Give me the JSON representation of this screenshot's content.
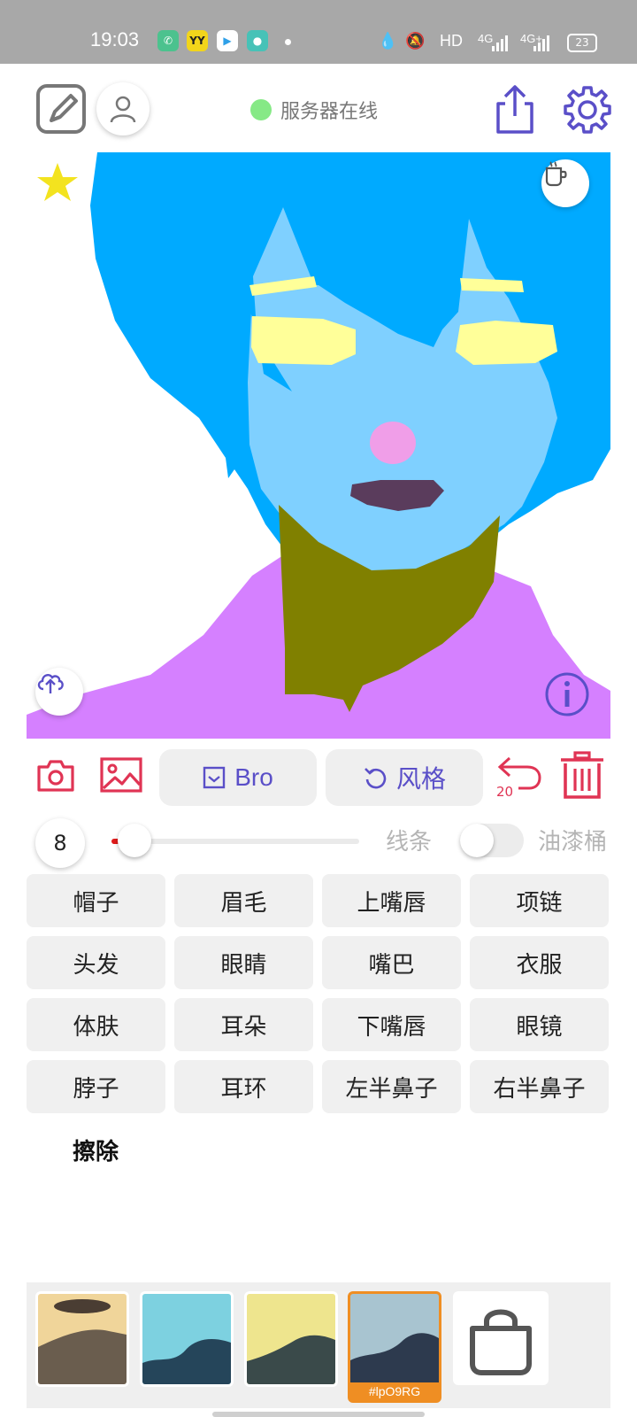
{
  "status_bar": {
    "time": "19:03",
    "network_label": "HD",
    "signal_label_1": "4G",
    "signal_label_2": "4G+",
    "battery": "23",
    "icons": [
      "phone-app-icon",
      "yy-app-icon",
      "video-app-icon",
      "chat-app-icon",
      "water-drop-icon",
      "mute-icon"
    ]
  },
  "toolbar": {
    "server_status": "服务器在线",
    "server_status_color": "#86e986",
    "icons": [
      "edit-icon",
      "user-icon",
      "share-icon",
      "settings-icon"
    ]
  },
  "canvas": {
    "icons": [
      "star-icon",
      "coffee-icon",
      "upload-cloud-icon",
      "info-icon"
    ]
  },
  "actions": {
    "model_label": "Bro",
    "style_label": "风格",
    "undo_count": "20",
    "icons": [
      "camera-icon",
      "image-icon",
      "checkbox-icon",
      "refresh-icon",
      "undo-icon",
      "trash-icon"
    ]
  },
  "brush": {
    "size": "8",
    "line_label": "线条",
    "bucket_label": "油漆桶",
    "slider_fraction": 0.04,
    "bucket_enabled": false
  },
  "parts": [
    "帽子",
    "眉毛",
    "上嘴唇",
    "项链",
    "头发",
    "眼睛",
    "嘴巴",
    "衣服",
    "体肤",
    "耳朵",
    "下嘴唇",
    "眼镜",
    "脖子",
    "耳环",
    "左半鼻子",
    "右半鼻子"
  ],
  "erase_label": "擦除",
  "thumbnails": {
    "selected_label": "#lpO9RG"
  },
  "colors": {
    "accent_purple": "#5a4fc8",
    "accent_red": "#e03454",
    "hair": "#00aaff",
    "skin": "#7fd0ff",
    "clothes": "#d580ff",
    "neck": "#808000",
    "eyes": "#ffff99",
    "nose": "#f09ee8",
    "mouth": "#5a3c5c",
    "selected_border": "#ef8e23"
  }
}
